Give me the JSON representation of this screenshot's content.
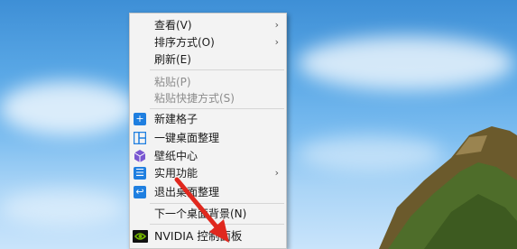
{
  "menu": {
    "items": [
      {
        "label": "查看(V)",
        "submenu_arrow": "›"
      },
      {
        "label": "排序方式(O)",
        "submenu_arrow": "›"
      },
      {
        "label": "刷新(E)"
      },
      {
        "label": "粘贴(P)",
        "disabled": true
      },
      {
        "label": "粘贴快捷方式(S)",
        "disabled": true
      },
      {
        "label": "新建格子",
        "icon": "plus-icon",
        "icon_glyph": "+"
      },
      {
        "label": "一键桌面整理",
        "icon": "grid-layout-icon"
      },
      {
        "label": "壁纸中心",
        "icon": "cube-icon"
      },
      {
        "label": "实用功能",
        "icon": "list-icon",
        "icon_glyph": "☰",
        "submenu_arrow": "›"
      },
      {
        "label": "退出桌面整理",
        "icon": "exit-icon",
        "icon_glyph": "↩"
      },
      {
        "label": "下一个桌面背景(N)"
      },
      {
        "label": "NVIDIA 控制面板",
        "icon": "nvidia-icon"
      }
    ]
  },
  "colors": {
    "menu_bg": "#f3f3f3",
    "icon_blue": "#1f7fe0",
    "annotation_arrow": "#e0281e"
  }
}
